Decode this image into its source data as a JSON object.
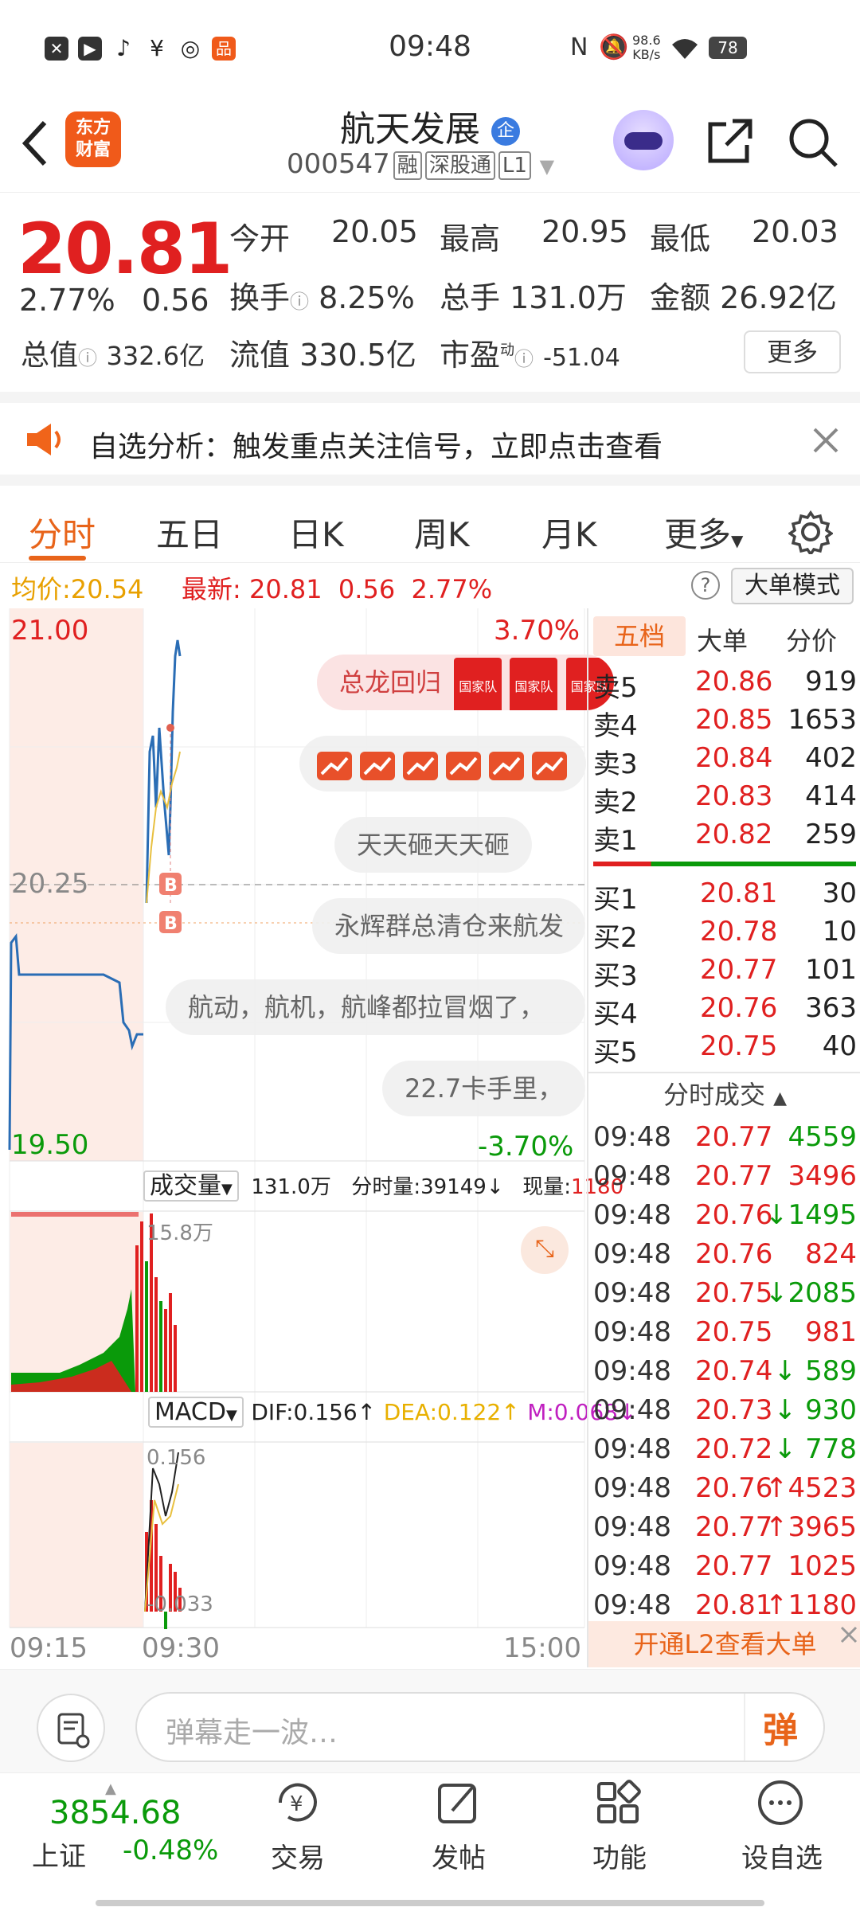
{
  "status_bar": {
    "time": "09:48",
    "net_speed_top": "98.6",
    "net_speed_unit": "KB/s",
    "battery": "78"
  },
  "header": {
    "logo_line1": "东方",
    "logo_line2": "财富",
    "title": "航天发展",
    "badge": "企",
    "code": "000547",
    "tags": [
      "融",
      "深股通",
      "L1"
    ]
  },
  "quote": {
    "price": "20.81",
    "pct": "2.77%",
    "change": "0.56",
    "open_label": "今开",
    "open": "20.05",
    "high_label": "最高",
    "high": "20.95",
    "low_label": "最低",
    "low": "20.03",
    "turnover_label": "换手",
    "turnover": "8.25%",
    "volume_label": "总手",
    "volume": "131.0万",
    "amount_label": "金额",
    "amount": "26.92亿",
    "mktcap_label": "总值",
    "mktcap": "332.6亿",
    "float_label": "流值",
    "float": "330.5亿",
    "pe_label": "市盈",
    "pe_sup": "动",
    "pe": "-51.04",
    "more": "更多"
  },
  "notice": {
    "text": "自选分析：触发重点关注信号，立即点击查看"
  },
  "tabs": [
    {
      "label": "分时"
    },
    {
      "label": "五日"
    },
    {
      "label": "日K"
    },
    {
      "label": "周K"
    },
    {
      "label": "月K"
    },
    {
      "label": "更多"
    }
  ],
  "info_bar": {
    "avg_label": "均价:",
    "avg": "20.54",
    "latest_label": "最新:",
    "latest": "20.81",
    "chg": "0.56",
    "pct": "2.77%",
    "mode_button": "大单模式"
  },
  "chart": {
    "top_price": "21.00",
    "mid_price": "20.25",
    "bottom_price": "19.50",
    "top_pct": "3.70%",
    "bottom_pct": "-3.70%",
    "time_start": "09:15",
    "time_mid": "09:30",
    "time_end": "15:00",
    "buy_marker": "B"
  },
  "volume_panel": {
    "label": "成交量",
    "total": "131.0万",
    "bar_vol": "分时量:39149↓",
    "now_label": "现量:",
    "now": "1180",
    "axis_max": "15.8万"
  },
  "macd_panel": {
    "label": "MACD",
    "dif": "DIF:0.156↑",
    "dea": "DEA:0.122↑",
    "m": "M:0.068↓",
    "axis_max": "0.156",
    "axis_min": "-0.033"
  },
  "danmaku": [
    {
      "text": "总龙回归",
      "badge": "国家队"
    },
    {
      "text": "天天砸天天砸"
    },
    {
      "text": "永辉群总清仓来航发"
    },
    {
      "text": "航动，航机，航峰都拉冒烟了，"
    },
    {
      "text": "22.7卡手里，"
    }
  ],
  "order_book": {
    "tabs": [
      "五档",
      "大单",
      "分价"
    ],
    "asks": [
      {
        "label": "卖5",
        "price": "20.86",
        "qty": "919"
      },
      {
        "label": "卖4",
        "price": "20.85",
        "qty": "1653"
      },
      {
        "label": "卖3",
        "price": "20.84",
        "qty": "402"
      },
      {
        "label": "卖2",
        "price": "20.83",
        "qty": "414"
      },
      {
        "label": "卖1",
        "price": "20.82",
        "qty": "259"
      }
    ],
    "bids": [
      {
        "label": "买1",
        "price": "20.81",
        "qty": "30"
      },
      {
        "label": "买2",
        "price": "20.78",
        "qty": "10"
      },
      {
        "label": "买3",
        "price": "20.77",
        "qty": "101"
      },
      {
        "label": "买4",
        "price": "20.76",
        "qty": "363"
      },
      {
        "label": "买5",
        "price": "20.75",
        "qty": "40"
      }
    ],
    "ticks_title": "分时成交",
    "ticks": [
      {
        "time": "09:48",
        "price": "20.77",
        "qty": "4559",
        "dir": ""
      },
      {
        "time": "09:48",
        "price": "20.77",
        "qty": "3496",
        "dir": ""
      },
      {
        "time": "09:48",
        "price": "20.76",
        "qty": "↓1495",
        "dir": "down"
      },
      {
        "time": "09:48",
        "price": "20.76",
        "qty": "824",
        "dir": ""
      },
      {
        "time": "09:48",
        "price": "20.75",
        "qty": "↓2085",
        "dir": "down"
      },
      {
        "time": "09:48",
        "price": "20.75",
        "qty": "981",
        "dir": ""
      },
      {
        "time": "09:48",
        "price": "20.74",
        "qty": "↓ 589",
        "dir": "down"
      },
      {
        "time": "09:48",
        "price": "20.73",
        "qty": "↓ 930",
        "dir": "down"
      },
      {
        "time": "09:48",
        "price": "20.72",
        "qty": "↓ 778",
        "dir": "down"
      },
      {
        "time": "09:48",
        "price": "20.76",
        "qty": "↑4523",
        "dir": "up"
      },
      {
        "time": "09:48",
        "price": "20.77",
        "qty": "↑3965",
        "dir": "up"
      },
      {
        "time": "09:48",
        "price": "20.77",
        "qty": "1025",
        "dir": ""
      },
      {
        "time": "09:48",
        "price": "20.81",
        "qty": "↑1180",
        "dir": "up"
      }
    ],
    "l2_banner": "开通L2查看大单"
  },
  "comment_input": {
    "placeholder": "弹幕走一波…",
    "send": "弹"
  },
  "bottom_nav": {
    "index_value": "3854.68",
    "index_name": "上证",
    "index_pct": "-0.48%",
    "items": [
      {
        "label": "交易"
      },
      {
        "label": "发帖"
      },
      {
        "label": "功能"
      },
      {
        "label": "设自选"
      }
    ]
  },
  "colors": {
    "up": "#e02020",
    "down": "#0a9a0a",
    "accent": "#e8641a",
    "price_line": "#2a6db5"
  }
}
